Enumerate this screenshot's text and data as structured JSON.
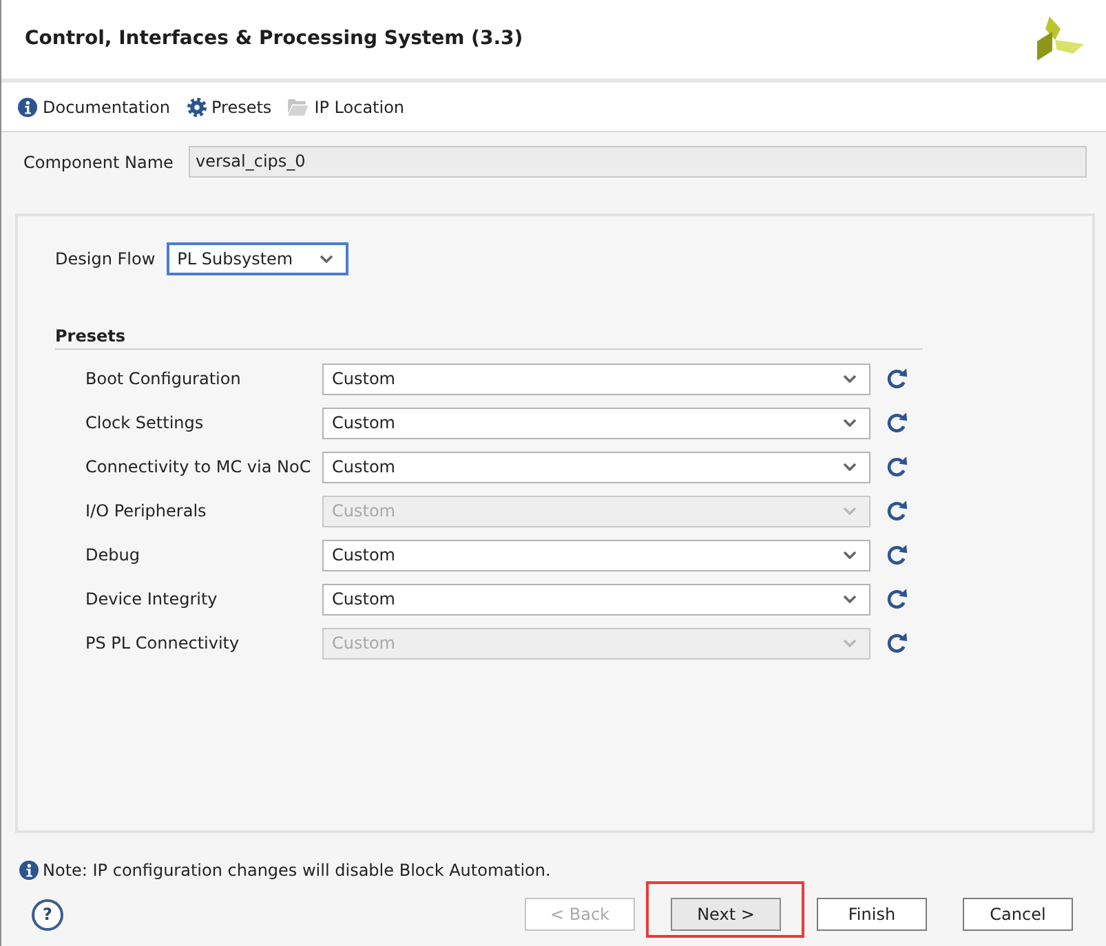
{
  "window": {
    "title": "Control, Interfaces & Processing System (3.3)"
  },
  "toolbar": [
    {
      "kind": "info",
      "label": "Documentation"
    },
    {
      "kind": "gear",
      "label": "Presets"
    },
    {
      "kind": "folder",
      "label": "IP Location"
    }
  ],
  "component_name": {
    "label": "Component Name",
    "value": "versal_cips_0"
  },
  "design_flow": {
    "label": "Design Flow",
    "value": "PL Subsystem",
    "focused": true
  },
  "presets": {
    "heading": "Presets",
    "rows": [
      {
        "label": "Boot Configuration",
        "value": "Custom",
        "disabled": false
      },
      {
        "label": "Clock Settings",
        "value": "Custom",
        "disabled": false
      },
      {
        "label": "Connectivity to MC via NoC",
        "value": "Custom",
        "disabled": false
      },
      {
        "label": "I/O Peripherals",
        "value": "Custom",
        "disabled": true
      },
      {
        "label": "Debug",
        "value": "Custom",
        "disabled": false
      },
      {
        "label": "Device Integrity",
        "value": "Custom",
        "disabled": false
      },
      {
        "label": "PS PL Connectivity",
        "value": "Custom",
        "disabled": true
      }
    ]
  },
  "note": {
    "text": "Note: IP configuration changes will disable Block Automation."
  },
  "help": {
    "label": "?"
  },
  "buttons": [
    {
      "label": "< Back",
      "disabled": true,
      "default": false,
      "highlighted": false
    },
    {
      "label": "Next >",
      "disabled": false,
      "default": true,
      "highlighted": true
    },
    {
      "label": "Finish",
      "disabled": false,
      "default": false,
      "highlighted": false
    },
    {
      "label": "Cancel",
      "disabled": false,
      "default": false,
      "highlighted": false
    }
  ]
}
